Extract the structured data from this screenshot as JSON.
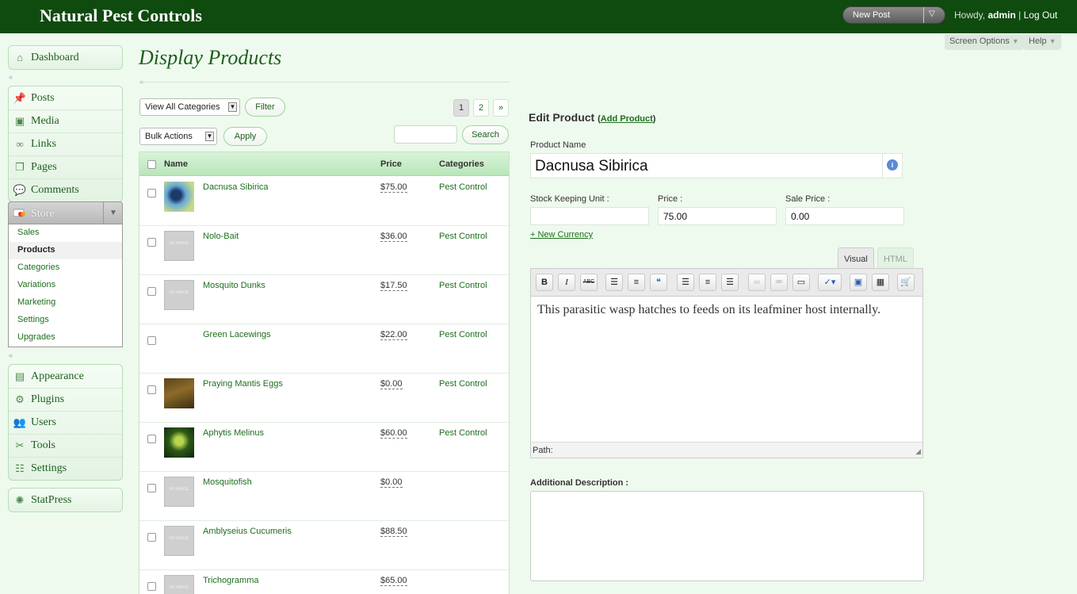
{
  "header": {
    "site_title": "Natural Pest Controls",
    "new_post_label": "New Post",
    "howdy_prefix": "Howdy,",
    "username": "admin",
    "separator": "|",
    "logout_label": "Log Out"
  },
  "screen_options": {
    "screen_options_label": "Screen Options",
    "help_label": "Help"
  },
  "sidebar": {
    "dashboard": "Dashboard",
    "posts": "Posts",
    "media": "Media",
    "links": "Links",
    "pages": "Pages",
    "comments": "Comments",
    "store": "Store",
    "store_items": [
      "Sales",
      "Products",
      "Categories",
      "Variations",
      "Marketing",
      "Settings",
      "Upgrades"
    ],
    "active_store_item": "Products",
    "appearance": "Appearance",
    "plugins": "Plugins",
    "users": "Users",
    "tools": "Tools",
    "settings": "Settings",
    "statpress": "StatPress"
  },
  "main": {
    "title": "Display Products",
    "category_filter": "View All Categories",
    "filter_button": "Filter",
    "bulk_actions": "Bulk Actions",
    "apply_button": "Apply",
    "search_value": "",
    "search_button": "Search",
    "pagination": [
      "1",
      "2",
      "»"
    ],
    "current_page": "1"
  },
  "table": {
    "columns": {
      "name": "Name",
      "price": "Price",
      "categories": "Categories"
    },
    "rows": [
      {
        "name": "Dacnusa Sibirica",
        "price": "$75.00",
        "category": "Pest Control",
        "image": "photo-insect-blue"
      },
      {
        "name": "Nolo-Bait",
        "price": "$36.00",
        "category": "Pest Control",
        "image": "no-image"
      },
      {
        "name": "Mosquito Dunks",
        "price": "$17.50",
        "category": "Pest Control",
        "image": "no-image"
      },
      {
        "name": "Green Lacewings",
        "price": "$22.00",
        "category": "Pest Control",
        "image": "none"
      },
      {
        "name": "Praying Mantis Eggs",
        "price": "$0.00",
        "category": "Pest Control",
        "image": "photo-mantis"
      },
      {
        "name": "Aphytis Melinus",
        "price": "$60.00",
        "category": "Pest Control",
        "image": "photo-insect-green"
      },
      {
        "name": "Mosquitofish",
        "price": "$0.00",
        "category": "",
        "image": "no-image"
      },
      {
        "name": "Amblyseius Cucumeris",
        "price": "$88.50",
        "category": "",
        "image": "no-image"
      },
      {
        "name": "Trichogramma",
        "price": "$65.00",
        "category": "",
        "image": "no-image"
      }
    ],
    "no_image_text": "NO IMAGE"
  },
  "edit": {
    "heading": "Edit Product",
    "open_paren": "(",
    "add_product_link": "Add Product",
    "close_paren": ")",
    "product_name_label": "Product Name",
    "product_name_value": "Dacnusa Sibirica",
    "sku_label": "Stock Keeping Unit :",
    "sku_value": "",
    "price_label": "Price :",
    "price_value": "75.00",
    "sale_price_label": "Sale Price :",
    "sale_price_value": "0.00",
    "new_currency_link": "+ New Currency",
    "visual_tab": "Visual",
    "html_tab": "HTML",
    "description": "This parasitic wasp hatches to feeds on its leafminer host internally.",
    "path_label": "Path:",
    "additional_description_label": "Additional Description :"
  },
  "toolbar": {
    "bold": "B",
    "italic": "I",
    "strike": "ABC",
    "bullet_list": "☰",
    "numbered_list": "≡",
    "blockquote": "❝",
    "align_left": "☰",
    "align_center": "≡",
    "align_right": "☰"
  },
  "colors": {
    "header_bg": "#0f4a0f",
    "body_bg": "#eefaee",
    "link": "#1e6e1e",
    "table_header": "#b9e6b9"
  }
}
